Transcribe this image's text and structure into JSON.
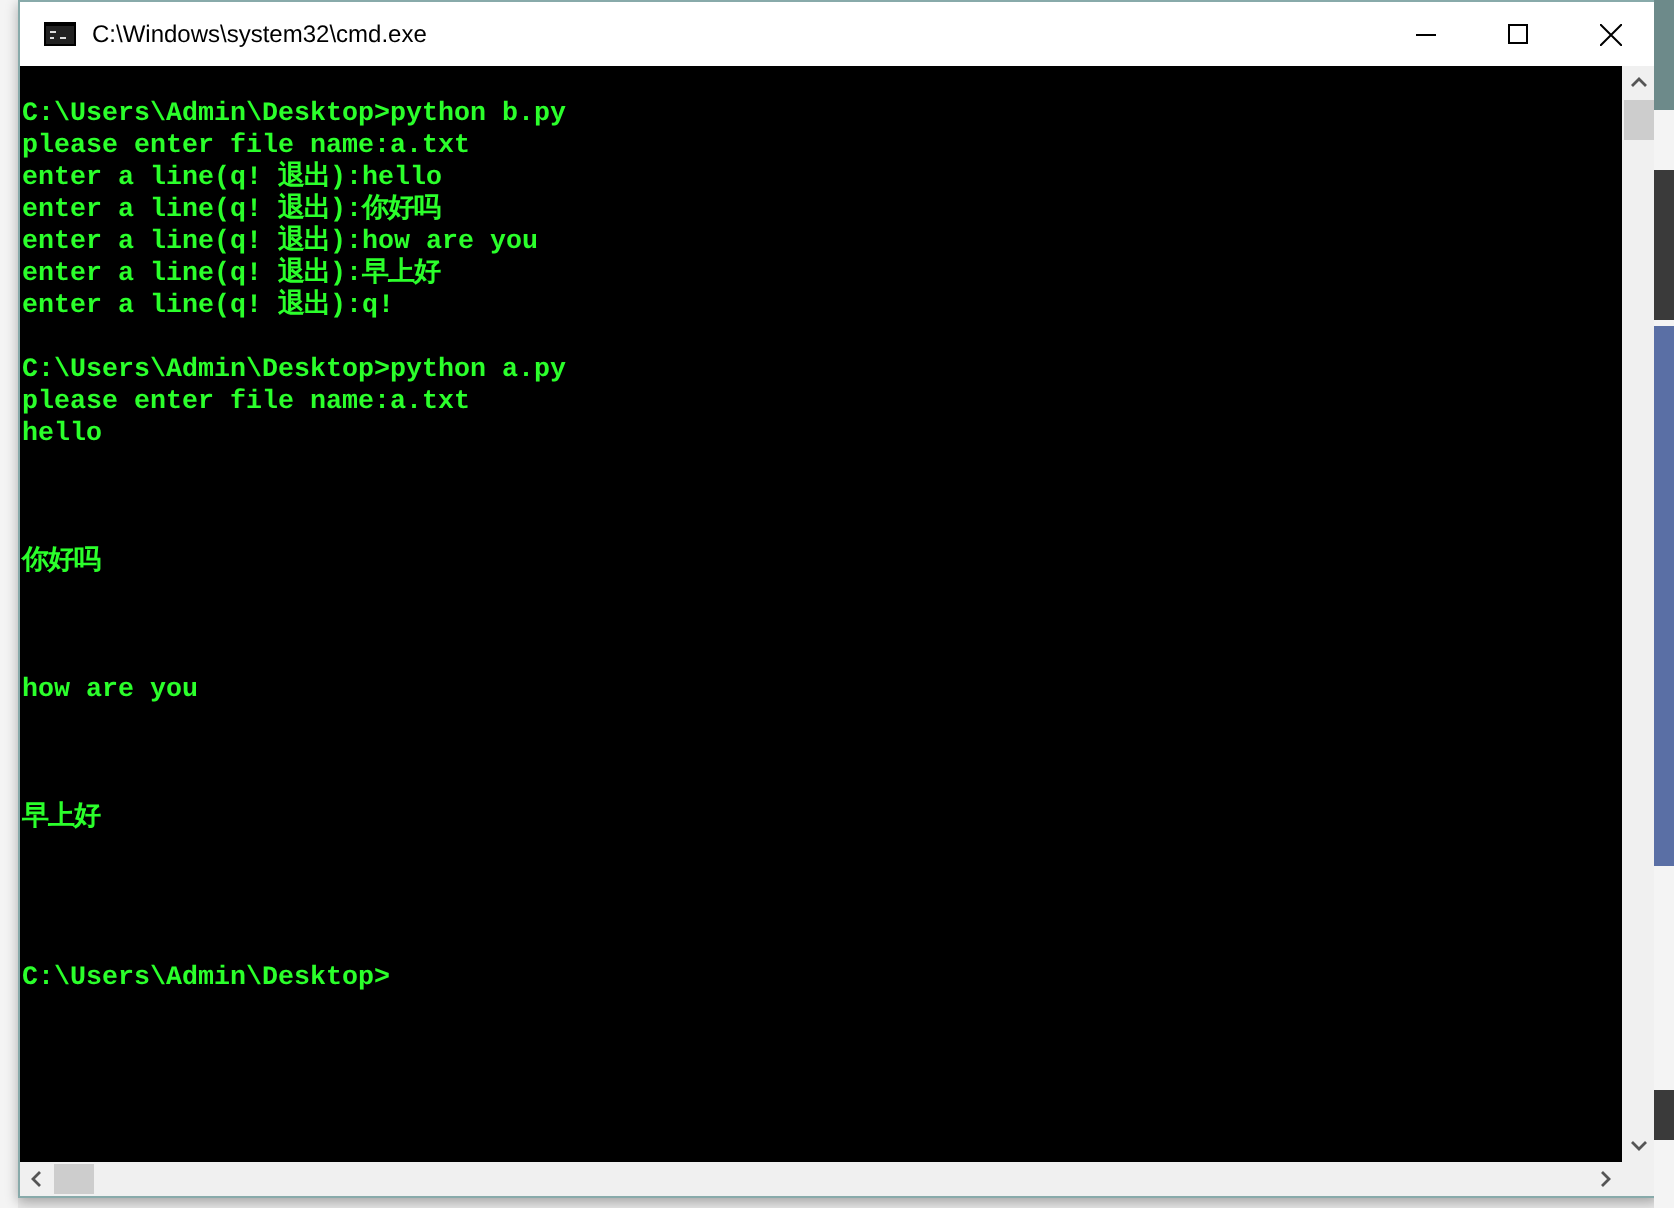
{
  "window": {
    "title": "C:\\Windows\\system32\\cmd.exe"
  },
  "console": [
    {
      "kind": "blank"
    },
    {
      "kind": "line",
      "text": "C:\\Users\\Admin\\Desktop>python b.py"
    },
    {
      "kind": "line",
      "text": "please enter file name:a.txt"
    },
    {
      "kind": "line",
      "text": "enter a line(q! 退出):hello"
    },
    {
      "kind": "line",
      "text": "enter a line(q! 退出):你好吗"
    },
    {
      "kind": "line",
      "text": "enter a line(q! 退出):how are you"
    },
    {
      "kind": "line",
      "text": "enter a line(q! 退出):早上好"
    },
    {
      "kind": "line",
      "text": "enter a line(q! 退出):q!"
    },
    {
      "kind": "blank"
    },
    {
      "kind": "line",
      "text": "C:\\Users\\Admin\\Desktop>python a.py"
    },
    {
      "kind": "line",
      "text": "please enter file name:a.txt"
    },
    {
      "kind": "line",
      "text": "hello"
    },
    {
      "kind": "blank"
    },
    {
      "kind": "blank"
    },
    {
      "kind": "blank"
    },
    {
      "kind": "line",
      "text": "你好吗"
    },
    {
      "kind": "blank"
    },
    {
      "kind": "blank"
    },
    {
      "kind": "blank"
    },
    {
      "kind": "line",
      "text": "how are you"
    },
    {
      "kind": "blank"
    },
    {
      "kind": "blank"
    },
    {
      "kind": "blank"
    },
    {
      "kind": "line",
      "text": "早上好"
    },
    {
      "kind": "blank"
    },
    {
      "kind": "blank"
    },
    {
      "kind": "blank"
    },
    {
      "kind": "blank"
    },
    {
      "kind": "line",
      "text": "C:\\Users\\Admin\\Desktop>"
    }
  ]
}
